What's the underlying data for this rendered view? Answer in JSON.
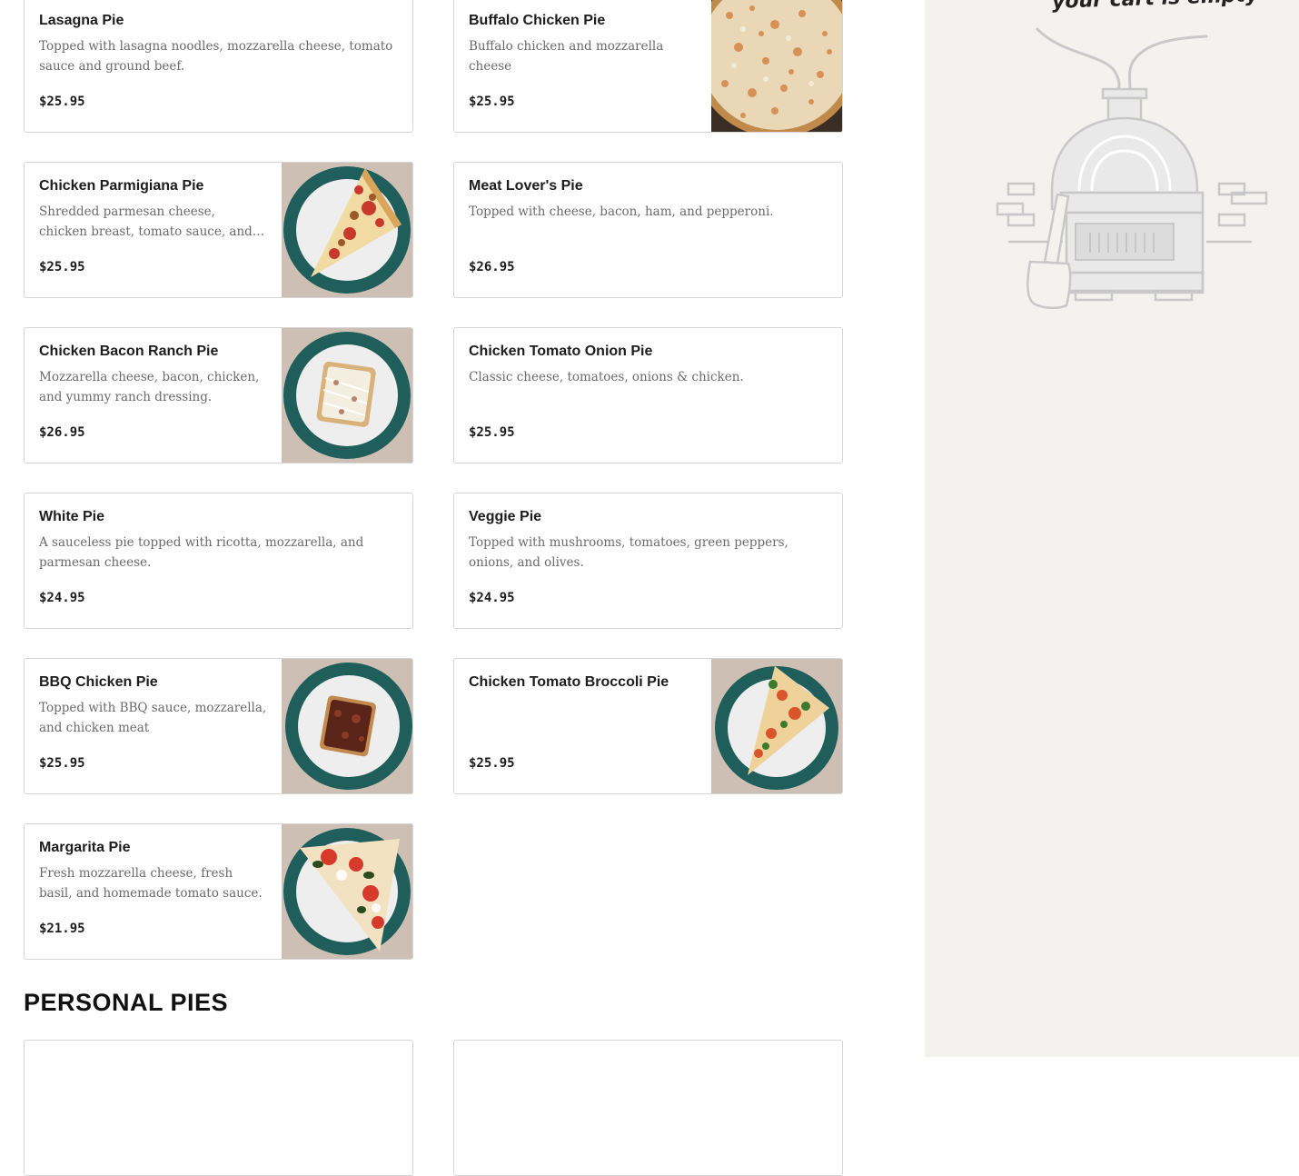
{
  "menu": {
    "items": [
      {
        "name": "Lasagna Pie",
        "description": "Topped with lasagna noodles, mozzarella cheese, tomato sauce and ground beef.",
        "price": "$25.95",
        "image": "none"
      },
      {
        "name": "Buffalo Chicken Pie",
        "description": "Buffalo chicken and mozzarella cheese",
        "price": "$25.95",
        "image": "buffalo-chicken-pie-photo"
      },
      {
        "name": "Chicken Parmigiana Pie",
        "description": "Shredded parmesan cheese, chicken breast, tomato sauce, and mozzarella cheese.",
        "price": "$25.95",
        "image": "chicken-parmigiana-slice-photo"
      },
      {
        "name": "Meat Lover's Pie",
        "description": "Topped with cheese, bacon, ham, and pepperoni.",
        "price": "$26.95",
        "image": "none"
      },
      {
        "name": "Chicken Bacon Ranch Pie",
        "description": "Mozzarella cheese, bacon, chicken, and yummy ranch dressing.",
        "price": "$26.95",
        "image": "chicken-bacon-ranch-slice-photo"
      },
      {
        "name": "Chicken Tomato Onion Pie",
        "description": "Classic cheese, tomatoes, onions & chicken.",
        "price": "$25.95",
        "image": "none"
      },
      {
        "name": "White Pie",
        "description": "A sauceless pie topped with ricotta, mozzarella, and parmesan cheese.",
        "price": "$24.95",
        "image": "none"
      },
      {
        "name": "Veggie Pie",
        "description": "Topped with mushrooms, tomatoes, green peppers, onions, and olives.",
        "price": "$24.95",
        "image": "none"
      },
      {
        "name": "BBQ Chicken Pie",
        "description": "Topped with BBQ sauce, mozzarella, and chicken meat",
        "price": "$25.95",
        "image": "bbq-chicken-slice-photo"
      },
      {
        "name": "Chicken Tomato Broccoli Pie",
        "description": "",
        "price": "$25.95",
        "image": "chicken-tomato-broccoli-slice-photo"
      },
      {
        "name": "Margarita Pie",
        "description": "Fresh mozzarella cheese, fresh basil, and homemade tomato sauce.",
        "price": "$21.95",
        "image": "margarita-slice-photo"
      }
    ]
  },
  "section": {
    "title": "PERSONAL PIES"
  },
  "cart": {
    "empty_message": "your cart is empty",
    "illustration": "pizza-oven-icon"
  },
  "colors": {
    "cart_bg": "#f3f2ef",
    "border": "#d6d6d6",
    "plate_green": "#1f5e5b"
  }
}
